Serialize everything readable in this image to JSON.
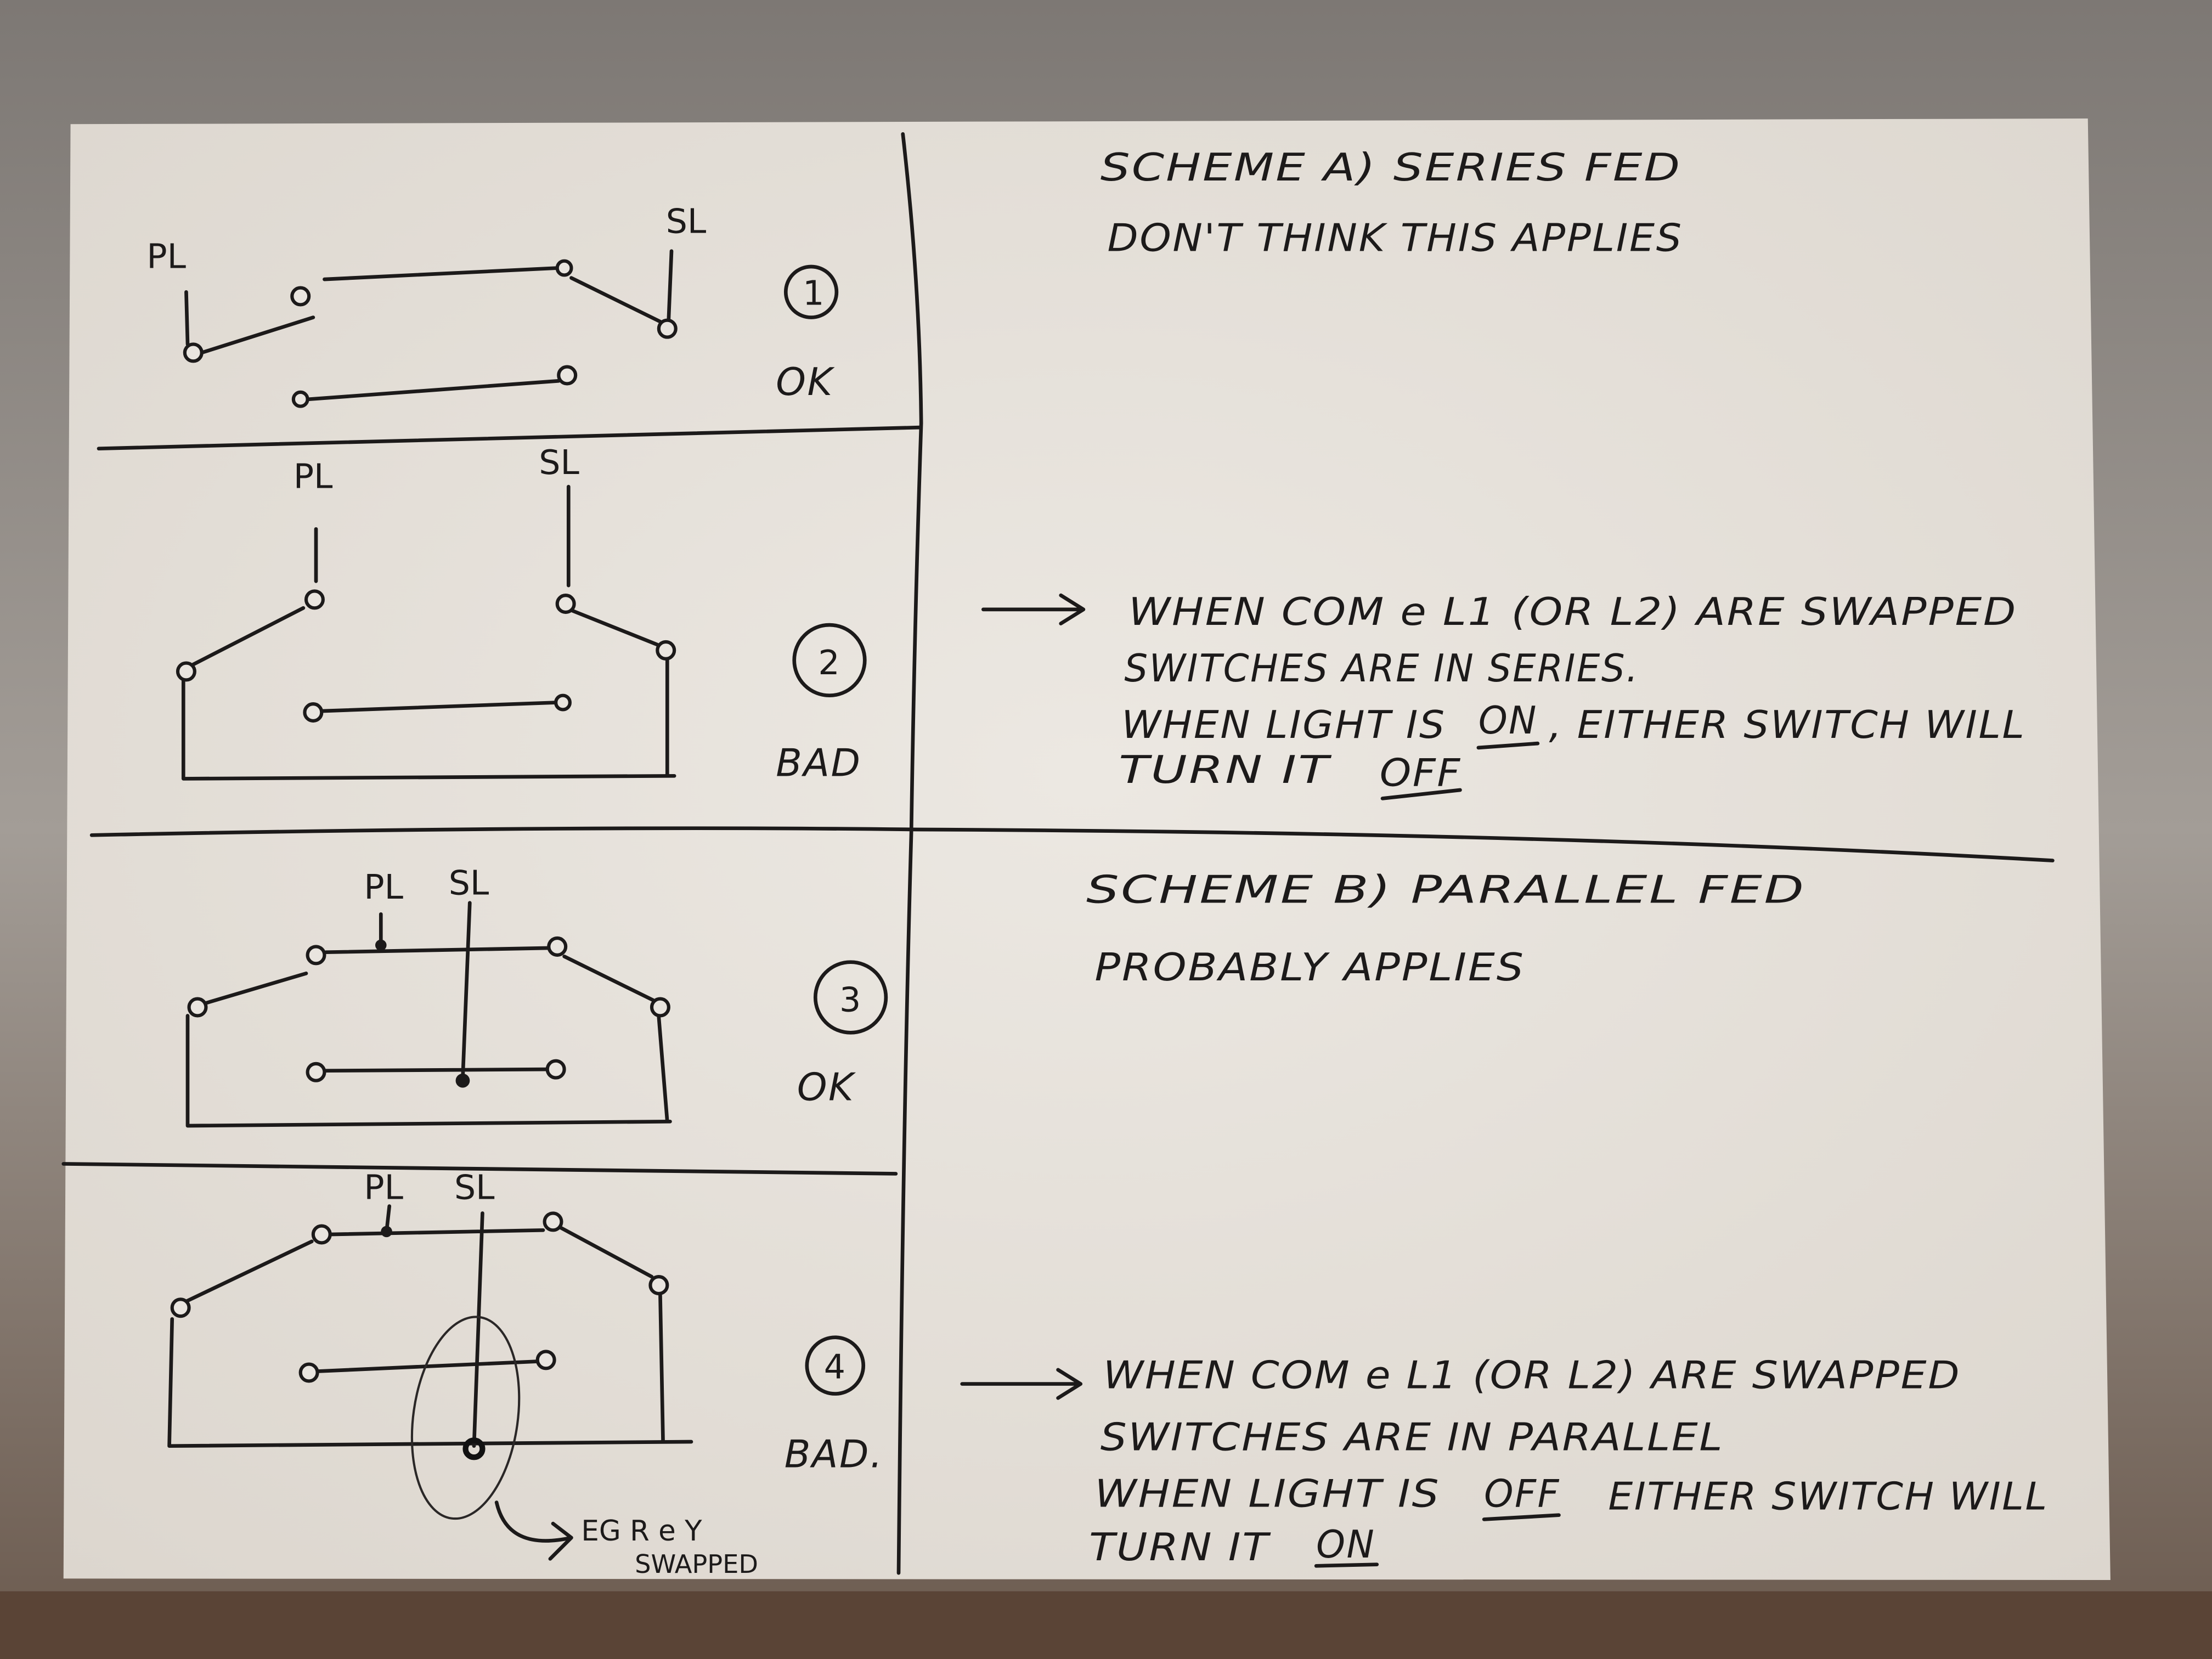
{
  "colors": {
    "paper": "#e9e5df",
    "ink": "#1c1a1a",
    "wall": "#8f8a85"
  },
  "diagrams": [
    {
      "number": "1",
      "pl": "PL",
      "sl": "SL",
      "verdict": "OK"
    },
    {
      "number": "2",
      "pl": "PL",
      "sl": "SL",
      "verdict": "BAD"
    },
    {
      "number": "3",
      "pl": "PL",
      "sl": "SL",
      "verdict": "OK"
    },
    {
      "number": "4",
      "pl": "PL",
      "sl": "SL",
      "verdict": "BAD.",
      "annotation_1": "EG R e Y",
      "annotation_2": "SWAPPED"
    }
  ],
  "notes": {
    "scheme_a": {
      "title": "SCHEME A) SERIES FED",
      "subtitle": "DON'T THINK THIS APPLIES"
    },
    "note_a": {
      "line1": "WHEN COM e L1 (OR L2) ARE SWAPPED",
      "line2": "SWITCHES ARE IN SERIES.",
      "line3_a": "WHEN LIGHT IS",
      "line3_em": "ON",
      "line3_b": ", EITHER SWITCH WILL",
      "line4_a": "TURN IT",
      "line4_em": "OFF"
    },
    "scheme_b": {
      "title": "SCHEME B) PARALLEL FED",
      "subtitle": "PROBABLY APPLIES"
    },
    "note_b": {
      "line1": "WHEN COM e L1 (OR L2) ARE SWAPPED",
      "line2": "SWITCHES ARE IN PARALLEL",
      "line3_a": "WHEN LIGHT IS",
      "line3_em": "OFF",
      "line3_b": "EITHER SWITCH WILL",
      "line4_a": "TURN IT",
      "line4_em": "ON"
    }
  }
}
